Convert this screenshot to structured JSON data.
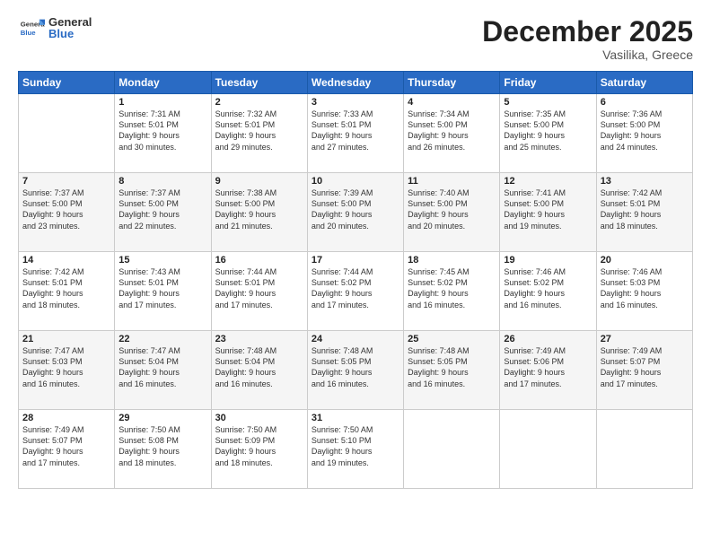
{
  "header": {
    "logo_general": "General",
    "logo_blue": "Blue",
    "month": "December 2025",
    "location": "Vasilika, Greece"
  },
  "weekdays": [
    "Sunday",
    "Monday",
    "Tuesday",
    "Wednesday",
    "Thursday",
    "Friday",
    "Saturday"
  ],
  "weeks": [
    [
      {
        "day": "",
        "info": ""
      },
      {
        "day": "1",
        "info": "Sunrise: 7:31 AM\nSunset: 5:01 PM\nDaylight: 9 hours\nand 30 minutes."
      },
      {
        "day": "2",
        "info": "Sunrise: 7:32 AM\nSunset: 5:01 PM\nDaylight: 9 hours\nand 29 minutes."
      },
      {
        "day": "3",
        "info": "Sunrise: 7:33 AM\nSunset: 5:01 PM\nDaylight: 9 hours\nand 27 minutes."
      },
      {
        "day": "4",
        "info": "Sunrise: 7:34 AM\nSunset: 5:00 PM\nDaylight: 9 hours\nand 26 minutes."
      },
      {
        "day": "5",
        "info": "Sunrise: 7:35 AM\nSunset: 5:00 PM\nDaylight: 9 hours\nand 25 minutes."
      },
      {
        "day": "6",
        "info": "Sunrise: 7:36 AM\nSunset: 5:00 PM\nDaylight: 9 hours\nand 24 minutes."
      }
    ],
    [
      {
        "day": "7",
        "info": "Sunrise: 7:37 AM\nSunset: 5:00 PM\nDaylight: 9 hours\nand 23 minutes."
      },
      {
        "day": "8",
        "info": "Sunrise: 7:37 AM\nSunset: 5:00 PM\nDaylight: 9 hours\nand 22 minutes."
      },
      {
        "day": "9",
        "info": "Sunrise: 7:38 AM\nSunset: 5:00 PM\nDaylight: 9 hours\nand 21 minutes."
      },
      {
        "day": "10",
        "info": "Sunrise: 7:39 AM\nSunset: 5:00 PM\nDaylight: 9 hours\nand 20 minutes."
      },
      {
        "day": "11",
        "info": "Sunrise: 7:40 AM\nSunset: 5:00 PM\nDaylight: 9 hours\nand 20 minutes."
      },
      {
        "day": "12",
        "info": "Sunrise: 7:41 AM\nSunset: 5:00 PM\nDaylight: 9 hours\nand 19 minutes."
      },
      {
        "day": "13",
        "info": "Sunrise: 7:42 AM\nSunset: 5:01 PM\nDaylight: 9 hours\nand 18 minutes."
      }
    ],
    [
      {
        "day": "14",
        "info": "Sunrise: 7:42 AM\nSunset: 5:01 PM\nDaylight: 9 hours\nand 18 minutes."
      },
      {
        "day": "15",
        "info": "Sunrise: 7:43 AM\nSunset: 5:01 PM\nDaylight: 9 hours\nand 17 minutes."
      },
      {
        "day": "16",
        "info": "Sunrise: 7:44 AM\nSunset: 5:01 PM\nDaylight: 9 hours\nand 17 minutes."
      },
      {
        "day": "17",
        "info": "Sunrise: 7:44 AM\nSunset: 5:02 PM\nDaylight: 9 hours\nand 17 minutes."
      },
      {
        "day": "18",
        "info": "Sunrise: 7:45 AM\nSunset: 5:02 PM\nDaylight: 9 hours\nand 16 minutes."
      },
      {
        "day": "19",
        "info": "Sunrise: 7:46 AM\nSunset: 5:02 PM\nDaylight: 9 hours\nand 16 minutes."
      },
      {
        "day": "20",
        "info": "Sunrise: 7:46 AM\nSunset: 5:03 PM\nDaylight: 9 hours\nand 16 minutes."
      }
    ],
    [
      {
        "day": "21",
        "info": "Sunrise: 7:47 AM\nSunset: 5:03 PM\nDaylight: 9 hours\nand 16 minutes."
      },
      {
        "day": "22",
        "info": "Sunrise: 7:47 AM\nSunset: 5:04 PM\nDaylight: 9 hours\nand 16 minutes."
      },
      {
        "day": "23",
        "info": "Sunrise: 7:48 AM\nSunset: 5:04 PM\nDaylight: 9 hours\nand 16 minutes."
      },
      {
        "day": "24",
        "info": "Sunrise: 7:48 AM\nSunset: 5:05 PM\nDaylight: 9 hours\nand 16 minutes."
      },
      {
        "day": "25",
        "info": "Sunrise: 7:48 AM\nSunset: 5:05 PM\nDaylight: 9 hours\nand 16 minutes."
      },
      {
        "day": "26",
        "info": "Sunrise: 7:49 AM\nSunset: 5:06 PM\nDaylight: 9 hours\nand 17 minutes."
      },
      {
        "day": "27",
        "info": "Sunrise: 7:49 AM\nSunset: 5:07 PM\nDaylight: 9 hours\nand 17 minutes."
      }
    ],
    [
      {
        "day": "28",
        "info": "Sunrise: 7:49 AM\nSunset: 5:07 PM\nDaylight: 9 hours\nand 17 minutes."
      },
      {
        "day": "29",
        "info": "Sunrise: 7:50 AM\nSunset: 5:08 PM\nDaylight: 9 hours\nand 18 minutes."
      },
      {
        "day": "30",
        "info": "Sunrise: 7:50 AM\nSunset: 5:09 PM\nDaylight: 9 hours\nand 18 minutes."
      },
      {
        "day": "31",
        "info": "Sunrise: 7:50 AM\nSunset: 5:10 PM\nDaylight: 9 hours\nand 19 minutes."
      },
      {
        "day": "",
        "info": ""
      },
      {
        "day": "",
        "info": ""
      },
      {
        "day": "",
        "info": ""
      }
    ]
  ]
}
